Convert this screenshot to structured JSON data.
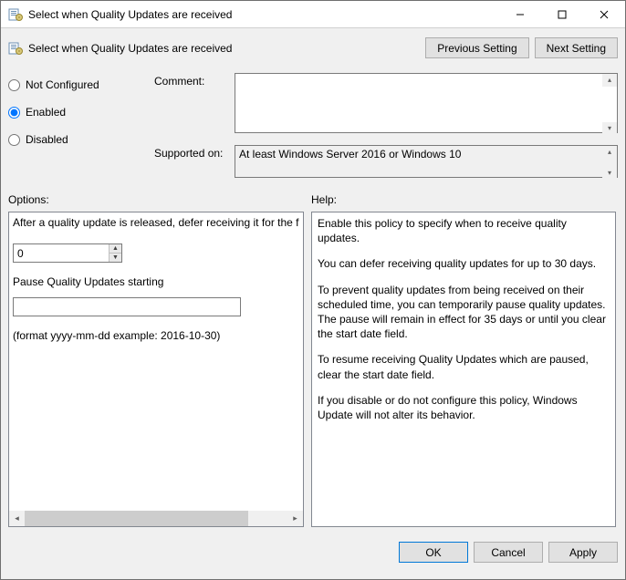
{
  "window": {
    "title": "Select when Quality Updates are received"
  },
  "header": {
    "title": "Select when Quality Updates are received",
    "prev_button": "Previous Setting",
    "next_button": "Next Setting"
  },
  "state": {
    "not_configured_label": "Not Configured",
    "enabled_label": "Enabled",
    "disabled_label": "Disabled",
    "selected": "enabled"
  },
  "fields": {
    "comment_label": "Comment:",
    "comment_value": "",
    "supported_label": "Supported on:",
    "supported_value": "At least Windows Server 2016 or Windows 10"
  },
  "options": {
    "label": "Options:",
    "defer_text": "After a quality update is released, defer receiving it for the following number of days:",
    "defer_value": "0",
    "pause_label": "Pause Quality Updates starting",
    "pause_value": "",
    "format_hint": "(format yyyy-mm-dd example: 2016-10-30)"
  },
  "help": {
    "label": "Help:",
    "p1": "Enable this policy to specify when to receive quality updates.",
    "p2": "You can defer receiving quality updates for up to 30 days.",
    "p3": "To prevent quality updates from being received on their scheduled time, you can temporarily pause quality updates. The pause will remain in effect for 35 days or until you clear the start date field.",
    "p4": "To resume receiving Quality Updates which are paused, clear the start date field.",
    "p5": "If you disable or do not configure this policy, Windows Update will not alter its behavior."
  },
  "footer": {
    "ok": "OK",
    "cancel": "Cancel",
    "apply": "Apply"
  }
}
